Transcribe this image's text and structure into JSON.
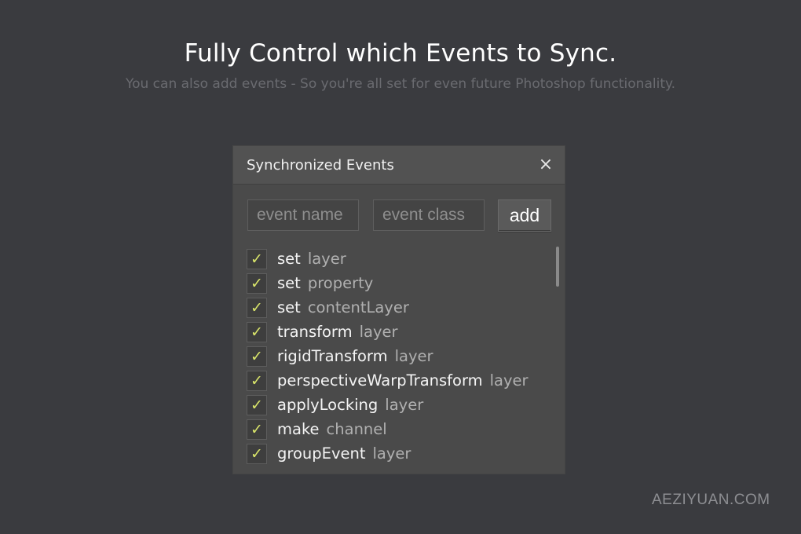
{
  "hero": {
    "title": "Fully Control which Events to Sync.",
    "subtitle": "You can also add events - So you're all set for even future Photoshop functionality."
  },
  "panel": {
    "title": "Synchronized Events",
    "close_icon": "×",
    "event_name_placeholder": "event name",
    "event_class_placeholder": "event class",
    "add_label": "add",
    "check_glyph": "✓",
    "events": [
      {
        "name": "set",
        "class": "layer",
        "checked": true
      },
      {
        "name": "set",
        "class": "property",
        "checked": true
      },
      {
        "name": "set",
        "class": "contentLayer",
        "checked": true
      },
      {
        "name": "transform",
        "class": "layer",
        "checked": true
      },
      {
        "name": "rigidTransform",
        "class": "layer",
        "checked": true
      },
      {
        "name": "perspectiveWarpTransform",
        "class": "layer",
        "checked": true
      },
      {
        "name": "applyLocking",
        "class": "layer",
        "checked": true
      },
      {
        "name": "make",
        "class": "channel",
        "checked": true
      },
      {
        "name": "groupEvent",
        "class": "layer",
        "checked": true
      }
    ]
  },
  "colors": {
    "background": "#3a3b3f",
    "panel": "#4a4a4a",
    "checkmark": "#d9e56a"
  },
  "watermark": "AEZIYUAN.COM"
}
